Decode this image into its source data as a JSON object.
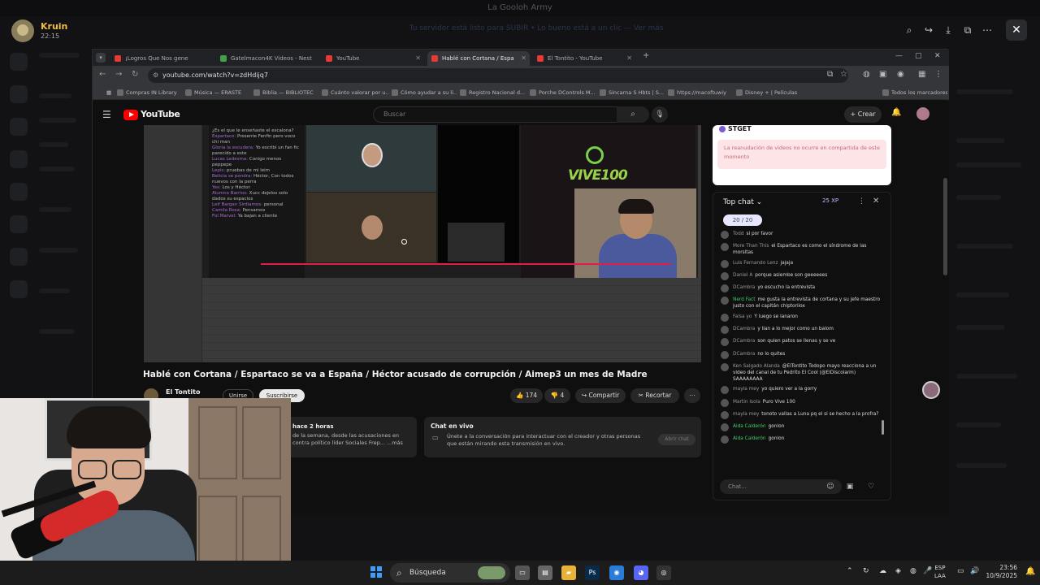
{
  "viewer": {
    "title": "La Gooloh Army",
    "user_name": "Kruin",
    "user_time": "22:15",
    "tools": [
      "zoom-icon",
      "share-icon",
      "download-icon",
      "open-external-icon",
      "more-icon"
    ],
    "close_label": "✕"
  },
  "browser": {
    "tabs": [
      {
        "label": "¡Logros Que Nos gene",
        "color": "#e53935"
      },
      {
        "label": "Gatelmacon4K Videos - Nest",
        "color": "#43a047"
      },
      {
        "label": "YouTube",
        "color": "#e53935"
      },
      {
        "label": "Hablé con Cortana / Espa",
        "color": "#e53935",
        "active": true
      },
      {
        "label": "El Tontito - YouTube",
        "color": "#e53935"
      }
    ],
    "url": "youtube.com/watch?v=zdHdijq7",
    "bookmarks": [
      "Compras IN Library",
      "Música — ERASTE",
      "Biblia — BIBLIOTEC",
      "Cuánto valorar por u...",
      "Cómo ayudar a su li...",
      "Registro Nacional d...",
      "Porche DControls M...",
      "Sincarna S Hbts | S...",
      "https://macoftuwiy",
      "Disney + | Películas",
      "Todos los marcadores"
    ]
  },
  "youtube": {
    "logo": "YouTube",
    "search_placeholder": "Buscar",
    "create_label": "+ Crear",
    "video_title": "Hablé con Cortana / Espartaco se va a España / Héctor acusado de corrupción / Aimep3 un mes de Madre",
    "channel_name": "El Tontito",
    "join_label": "Unirse",
    "subscribe_label": "Suscribirse",
    "likes": "174",
    "dislikes": "4",
    "share_label": "Compartir",
    "clip_label": "Recortar",
    "desc_meta": "hace 2 horas",
    "desc_text": "de la semana, desde las acusaciones en contra político líder Sociales Frep... ...más",
    "livechat_title": "Chat en vivo",
    "livechat_text": "Únete a la conversación para interactuar con el creador y otras personas que están mirando esta transmisión en vivo.",
    "livechat_btn": "Abrir chat",
    "stream_brand": "VIVE100",
    "overlay_chat": [
      {
        "name": "",
        "text": "¿Es el que le enseñaste el escalona?"
      },
      {
        "name": "Espartaco:",
        "text": "Presente Fenfin pero voco chi man"
      },
      {
        "name": "Gloria la escudera:",
        "text": "Yo escribí un fan fic parecido a este"
      },
      {
        "name": "Lucas Ledesma:",
        "text": "Conigo menos peppepe"
      },
      {
        "name": "Lepis:",
        "text": "pruebas de mi leim"
      },
      {
        "name": "Belicia se pondra:",
        "text": "Héctor, Con todos nuevos con la perra"
      },
      {
        "name": "Yes:",
        "text": "Los y Héctor"
      },
      {
        "name": "Alumno Barrios:",
        "text": "Xucc dejelos solo dados su espacios"
      },
      {
        "name": "Leif Bargan Sirdiamos:",
        "text": "personal"
      },
      {
        "name": "Camila Rosa:",
        "text": "Pensamos"
      },
      {
        "name": "Fol Marvel:",
        "text": "Ya bajan a cliente"
      }
    ]
  },
  "notice": {
    "header": "STGET",
    "text": "La reanudación de videos no ocurre en compartida de este momento"
  },
  "chat": {
    "header": "Top chat",
    "xp": "25 XP",
    "goal": "20 / 20",
    "input_placeholder": "Chat...",
    "messages": [
      {
        "name": "Todd",
        "green": false,
        "text": "si por favor"
      },
      {
        "name": "More Than This",
        "green": false,
        "text": "el Espartaco es como el síndrome de las morsitas"
      },
      {
        "name": "Luis Fernando Lenz",
        "green": false,
        "text": "jajaja"
      },
      {
        "name": "Daniel A",
        "green": false,
        "text": "porque asiembe son geeeeees"
      },
      {
        "name": "DCambra",
        "green": false,
        "text": "yo escucho la entrevista"
      },
      {
        "name": "Nerd Fact",
        "green": true,
        "text": "me gusta la entrevista de cortana y su jefe maestro justo con el capitán chiptoriiox"
      },
      {
        "name": "Falsa yo",
        "green": false,
        "text": "Y luego se lanaron"
      },
      {
        "name": "DCambra",
        "green": false,
        "text": "y llan a lo mejor como un balom"
      },
      {
        "name": "DCambra",
        "green": false,
        "text": "son quien patos se llenas y se ve"
      },
      {
        "name": "DCambra",
        "green": false,
        "text": "no lo quites"
      },
      {
        "name": "Ken Salgado Alanda",
        "green": false,
        "text": "@ElTontito Todopo mayo reacciona a un video del canal de tu Pedrito El Cool (@ElDiscolarm) SAAAAAAAA"
      },
      {
        "name": "mayla mey",
        "green": false,
        "text": "yo quiero ver a la gorry"
      },
      {
        "name": "Martin Isola",
        "green": false,
        "text": "Puro Vive 100"
      },
      {
        "name": "mayla mey",
        "green": false,
        "text": "tonoto vallas a Luna pq el si se hecho a la profra?"
      },
      {
        "name": "Aida Calderón",
        "green": true,
        "text": "gonlon"
      },
      {
        "name": "Aida Calderón",
        "green": true,
        "text": "gonlon"
      }
    ]
  },
  "taskbar": {
    "search_label": "Búsqueda",
    "apps": [
      {
        "name": "file-explorer-icon",
        "glyph": "▭",
        "color": "#555"
      },
      {
        "name": "notes-icon",
        "glyph": "▤",
        "color": "#666"
      },
      {
        "name": "folder-icon",
        "glyph": "▰",
        "color": "#e8b23a"
      },
      {
        "name": "photoshop-icon",
        "glyph": "Ps",
        "color": "#0a2a4a"
      },
      {
        "name": "chrome-icon",
        "glyph": "◉",
        "color": "#2b7bd9"
      },
      {
        "name": "discord-icon",
        "glyph": "◕",
        "color": "#5865f2"
      },
      {
        "name": "recorder-icon",
        "glyph": "◎",
        "color": "#333"
      }
    ],
    "lang_top": "ESP",
    "lang_bottom": "LAA",
    "time": "23:56",
    "date": "10/9/2025"
  },
  "background": {
    "banner": "Tu servidor está listo para SUBIR • Lo bueno está a un clic — Ver más"
  }
}
